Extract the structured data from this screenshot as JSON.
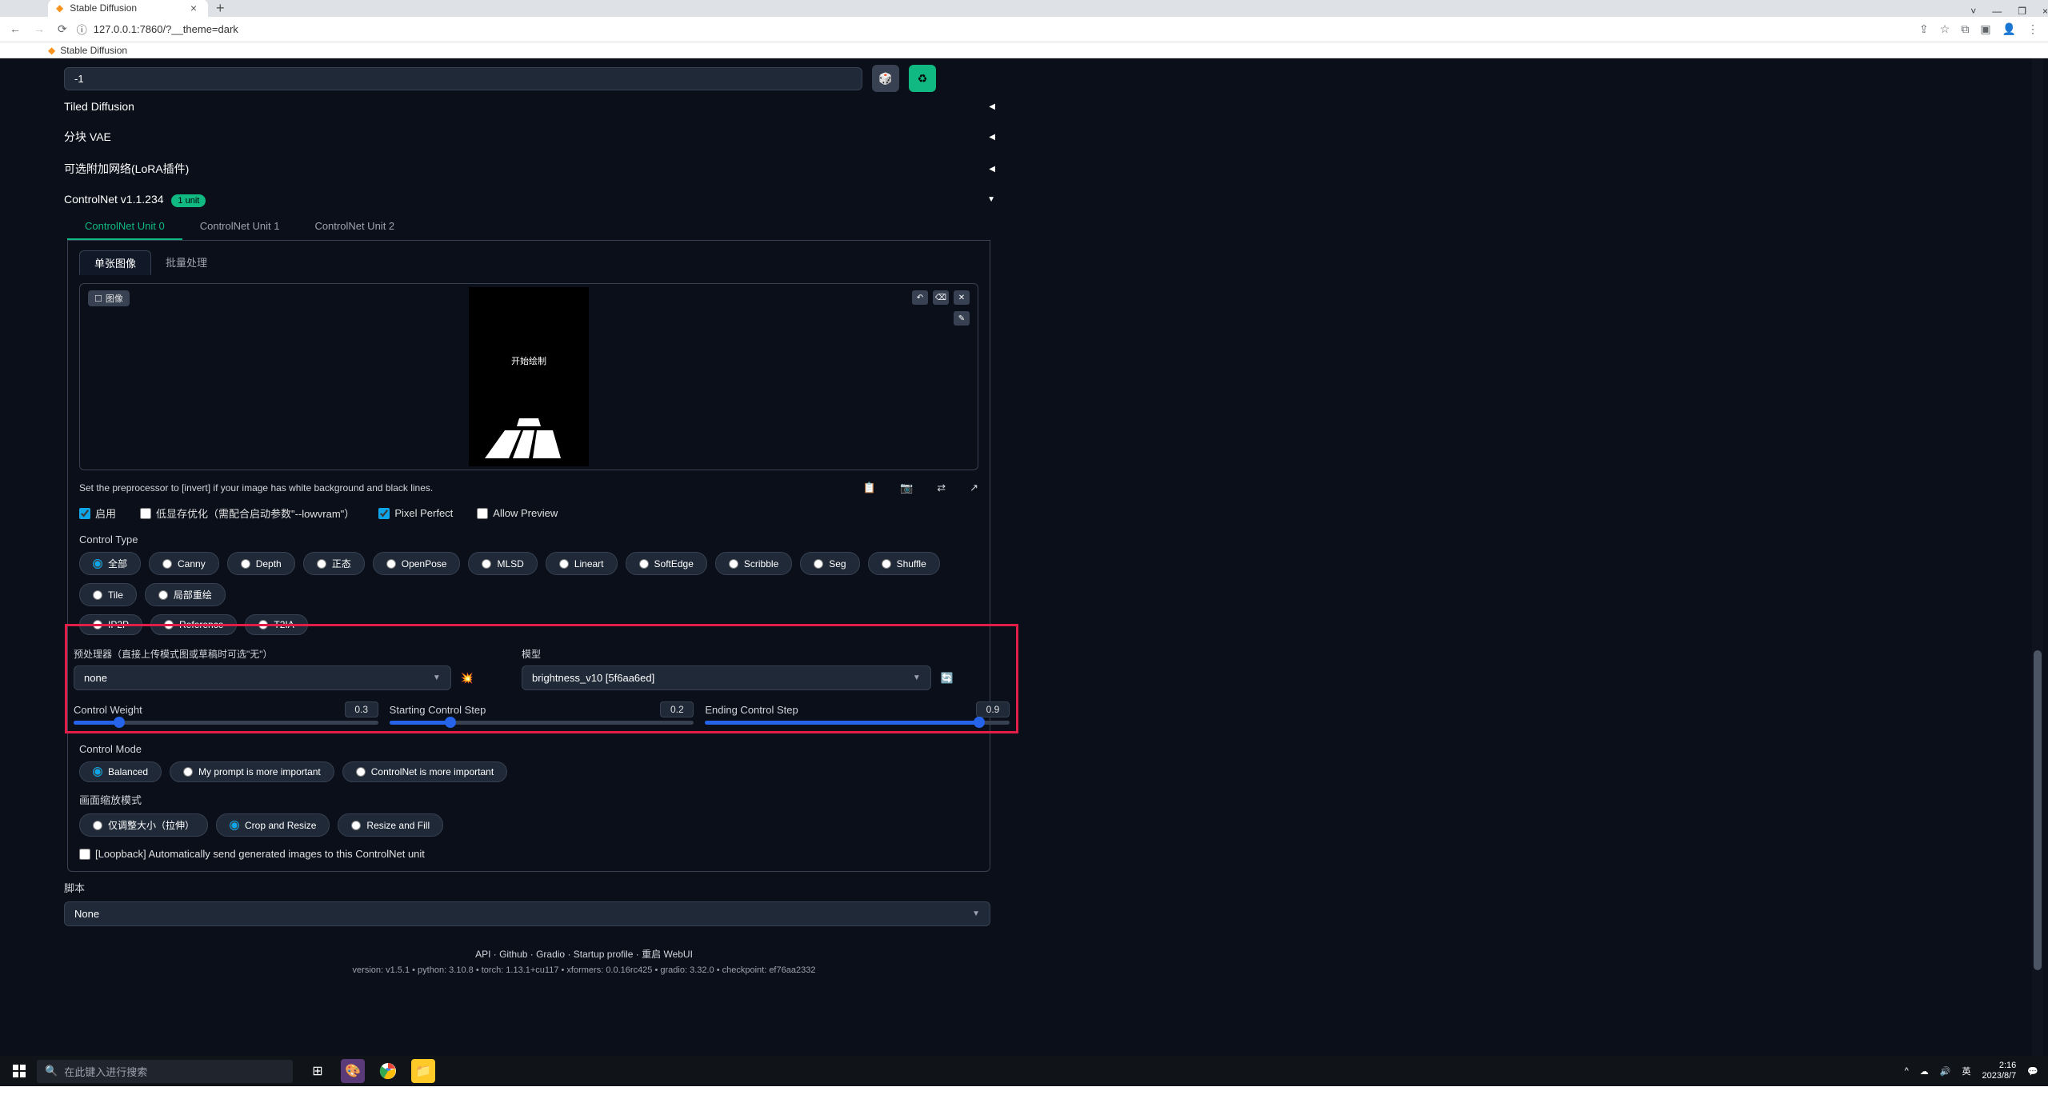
{
  "browser": {
    "tab_title": "Stable Diffusion",
    "new_tab": "+",
    "close": "×",
    "minimize": "—",
    "maximize": "❐",
    "url": "127.0.0.1:7860/?__theme=dark",
    "info_icon": "ⓘ",
    "bookmark_label": "Stable Diffusion"
  },
  "seed": {
    "value": "-1",
    "dice": "🎲",
    "recycle": "♻"
  },
  "accordions": {
    "tiled": "Tiled Diffusion",
    "vae": "分块 VAE",
    "lora": "可选附加网络(LoRA插件)",
    "cn_title": "ControlNet v1.1.234",
    "cn_badge": "1 unit"
  },
  "cn_tabs": [
    "ControlNet Unit 0",
    "ControlNet Unit 1",
    "ControlNet Unit 2"
  ],
  "inner_tabs": [
    "单张图像",
    "批量处理"
  ],
  "canvas": {
    "img_label": "图像",
    "center_label": "开始绘制"
  },
  "hint": "Set the preprocessor to [invert] if your image has white background and black lines.",
  "checks": {
    "enable": "启用",
    "lowvram": "低显存优化（需配合启动参数\"--lowvram\"）",
    "pixel": "Pixel Perfect",
    "preview": "Allow Preview"
  },
  "control_type": {
    "label": "Control Type",
    "options": [
      "全部",
      "Canny",
      "Depth",
      "正态",
      "OpenPose",
      "MLSD",
      "Lineart",
      "SoftEdge",
      "Scribble",
      "Seg",
      "Shuffle",
      "Tile",
      "局部重绘",
      "IP2P",
      "Reference",
      "T2IA"
    ]
  },
  "preprocessor": {
    "label": "预处理器（直接上传模式图或草稿时可选\"无\"）",
    "value": "none",
    "explode": "💥"
  },
  "model": {
    "label": "模型",
    "value": "brightness_v10 [5f6aa6ed]",
    "refresh": "🔄"
  },
  "sliders": {
    "weight": {
      "label": "Control Weight",
      "value": "0.3",
      "pct": 30
    },
    "start": {
      "label": "Starting Control Step",
      "value": "0.2",
      "pct": 20
    },
    "end": {
      "label": "Ending Control Step",
      "value": "0.9",
      "pct": 90
    }
  },
  "control_mode": {
    "label": "Control Mode",
    "options": [
      "Balanced",
      "My prompt is more important",
      "ControlNet is more important"
    ]
  },
  "resize": {
    "label": "画面缩放模式",
    "options": [
      "仅调整大小（拉伸）",
      "Crop and Resize",
      "Resize and Fill"
    ]
  },
  "loopback": "[Loopback] Automatically send generated images to this ControlNet unit",
  "script": {
    "label": "脚本",
    "value": "None"
  },
  "footer": {
    "links": "API  ·  Github  ·  Gradio  ·  Startup profile  ·  重启 WebUI",
    "meta": "version: v1.5.1  •  python: 3.10.8  •  torch: 1.13.1+cu117  •  xformers: 0.0.16rc425  •  gradio: 3.32.0  •  checkpoint: ef76aa2332"
  },
  "taskbar": {
    "search_placeholder": "在此键入进行搜索",
    "ime": "英",
    "time": "2:16",
    "date": "2023/8/7"
  }
}
